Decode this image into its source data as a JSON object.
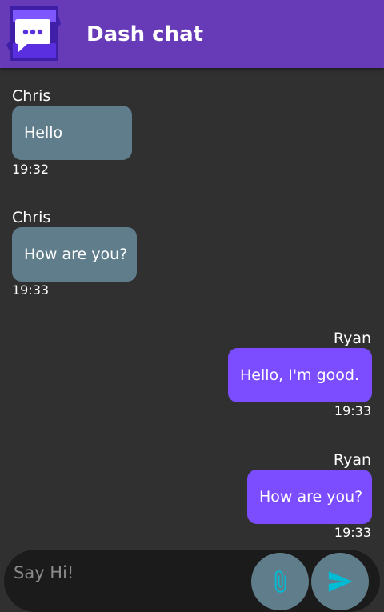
{
  "header": {
    "title": "Dash chat",
    "logo_icon": "chat-bubble-logo-icon",
    "color": "#673ab7"
  },
  "messages": [
    {
      "sender": "Chris",
      "text": "Hello",
      "time": "19:32",
      "direction": "incoming"
    },
    {
      "sender": "Chris",
      "text": "How are you?",
      "time": "19:33",
      "direction": "incoming"
    },
    {
      "sender": "Ryan",
      "text": "Hello, I'm good.",
      "time": "19:33",
      "direction": "outgoing"
    },
    {
      "sender": "Ryan",
      "text": "How are you?",
      "time": "19:33",
      "direction": "outgoing"
    }
  ],
  "composer": {
    "placeholder": "Say Hi!",
    "value": "",
    "attach_icon": "paperclip-icon",
    "send_icon": "send-icon"
  },
  "colors": {
    "background": "#303030",
    "incoming_bubble": "#607d8b",
    "outgoing_bubble": "#7c4dff",
    "icon_accent": "#00bcd4"
  }
}
